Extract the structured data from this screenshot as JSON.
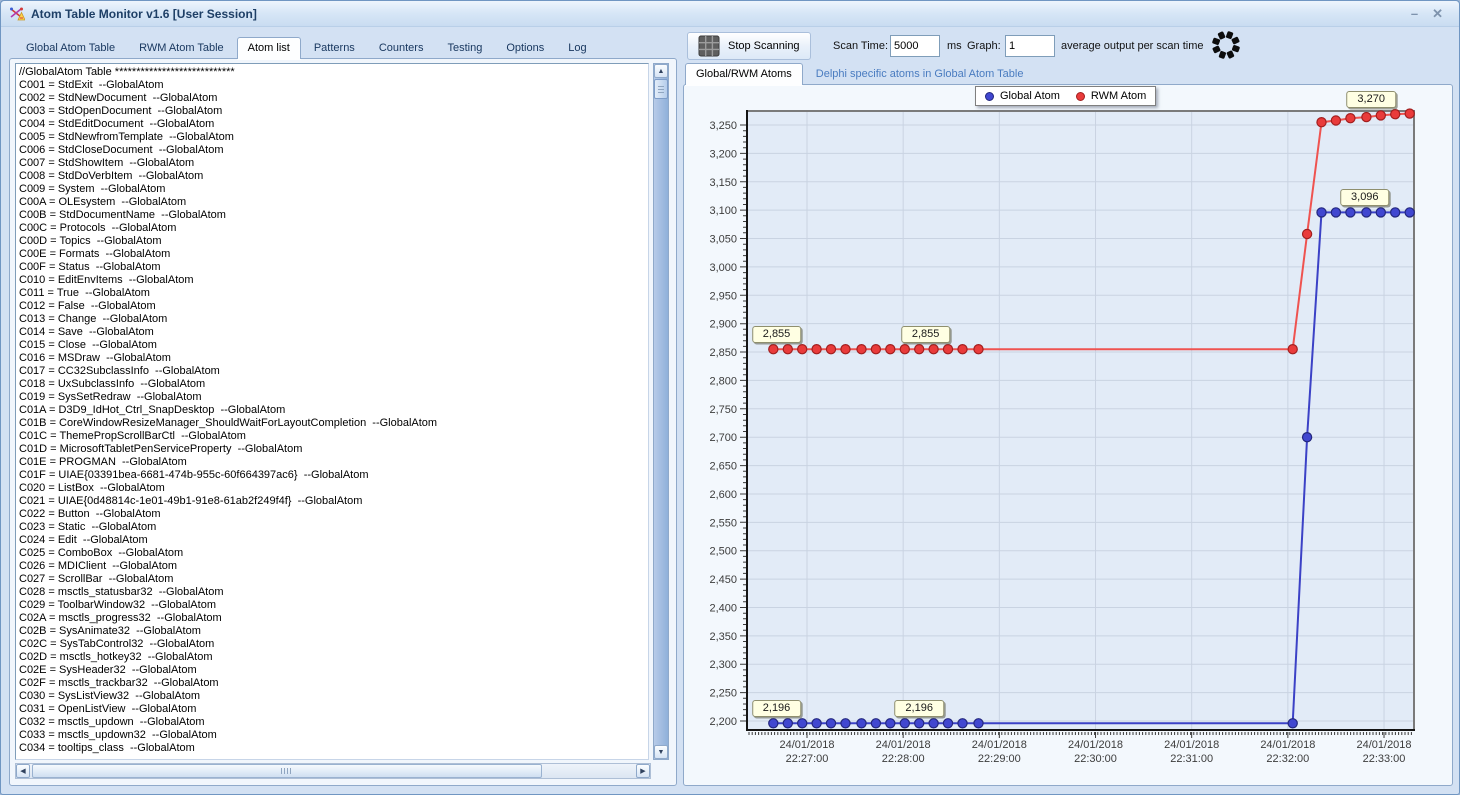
{
  "window": {
    "title": "Atom Table Monitor v1.6 [User Session]",
    "minimize_glyph": "–",
    "close_glyph": "✕"
  },
  "left_tabs": {
    "active_index": 2,
    "items": [
      "Global Atom Table",
      "RWM Atom Table",
      "Atom list",
      "Patterns",
      "Counters",
      "Testing",
      "Options",
      "Log"
    ]
  },
  "atom_list": {
    "lines": [
      "//GlobalAtom Table ****************************",
      "C001 = StdExit  --GlobalAtom",
      "C002 = StdNewDocument  --GlobalAtom",
      "C003 = StdOpenDocument  --GlobalAtom",
      "C004 = StdEditDocument  --GlobalAtom",
      "C005 = StdNewfromTemplate  --GlobalAtom",
      "C006 = StdCloseDocument  --GlobalAtom",
      "C007 = StdShowItem  --GlobalAtom",
      "C008 = StdDoVerbItem  --GlobalAtom",
      "C009 = System  --GlobalAtom",
      "C00A = OLEsystem  --GlobalAtom",
      "C00B = StdDocumentName  --GlobalAtom",
      "C00C = Protocols  --GlobalAtom",
      "C00D = Topics  --GlobalAtom",
      "C00E = Formats  --GlobalAtom",
      "C00F = Status  --GlobalAtom",
      "C010 = EditEnvItems  --GlobalAtom",
      "C011 = True  --GlobalAtom",
      "C012 = False  --GlobalAtom",
      "C013 = Change  --GlobalAtom",
      "C014 = Save  --GlobalAtom",
      "C015 = Close  --GlobalAtom",
      "C016 = MSDraw  --GlobalAtom",
      "C017 = CC32SubclassInfo  --GlobalAtom",
      "C018 = UxSubclassInfo  --GlobalAtom",
      "C019 = SysSetRedraw  --GlobalAtom",
      "C01A = D3D9_IdHot_Ctrl_SnapDesktop  --GlobalAtom",
      "C01B = CoreWindowResizeManager_ShouldWaitForLayoutCompletion  --GlobalAtom",
      "C01C = ThemePropScrollBarCtl  --GlobalAtom",
      "C01D = MicrosoftTabletPenServiceProperty  --GlobalAtom",
      "C01E = PROGMAN  --GlobalAtom",
      "C01F = UIAE{03391bea-6681-474b-955c-60f664397ac6}  --GlobalAtom",
      "C020 = ListBox  --GlobalAtom",
      "C021 = UIAE{0d48814c-1e01-49b1-91e8-61ab2f249f4f}  --GlobalAtom",
      "C022 = Button  --GlobalAtom",
      "C023 = Static  --GlobalAtom",
      "C024 = Edit  --GlobalAtom",
      "C025 = ComboBox  --GlobalAtom",
      "C026 = MDIClient  --GlobalAtom",
      "C027 = ScrollBar  --GlobalAtom",
      "C028 = msctls_statusbar32  --GlobalAtom",
      "C029 = ToolbarWindow32  --GlobalAtom",
      "C02A = msctls_progress32  --GlobalAtom",
      "C02B = SysAnimate32  --GlobalAtom",
      "C02C = SysTabControl32  --GlobalAtom",
      "C02D = msctls_hotkey32  --GlobalAtom",
      "C02E = SysHeader32  --GlobalAtom",
      "C02F = msctls_trackbar32  --GlobalAtom",
      "C030 = SysListView32  --GlobalAtom",
      "C031 = OpenListView  --GlobalAtom",
      "C032 = msctls_updown  --GlobalAtom",
      "C033 = msctls_updown32  --GlobalAtom",
      "C034 = tooltips_class  --GlobalAtom"
    ]
  },
  "toolbar": {
    "stop_button_label": "Stop Scanning",
    "scan_time_label": "Scan Time:",
    "scan_time_value": "5000",
    "ms_label": "ms",
    "graph_label": "Graph:",
    "graph_value": "1",
    "avg_label": "average output per scan time"
  },
  "right_tabs": {
    "active_index": 0,
    "items": [
      "Global/RWM Atoms",
      "Delphi specific atoms in Global Atom Table"
    ]
  },
  "chart_data": {
    "type": "line",
    "title": "",
    "xlabel": "",
    "ylabel": "",
    "ylim": [
      2200,
      3250
    ],
    "ytick_step": 50,
    "grid": true,
    "legend_position": "top-center",
    "legend": [
      {
        "name": "Global Atom",
        "color": "#4147d0",
        "stroke": "#23277e"
      },
      {
        "name": "RWM Atom",
        "color": "#e93b3b",
        "stroke": "#a21f1f"
      }
    ],
    "x_ticks": [
      {
        "date": "24/01/2018",
        "time": "22:27:00"
      },
      {
        "date": "24/01/2018",
        "time": "22:28:00"
      },
      {
        "date": "24/01/2018",
        "time": "22:29:00"
      },
      {
        "date": "24/01/2018",
        "time": "22:30:00"
      },
      {
        "date": "24/01/2018",
        "time": "22:31:00"
      },
      {
        "date": "24/01/2018",
        "time": "22:32:00"
      },
      {
        "date": "24/01/2018",
        "time": "22:33:00"
      }
    ],
    "series": [
      {
        "name": "Global Atom",
        "line_color": "#3b41c6",
        "marker_fill": "#4147d0",
        "marker_stroke": "#23277e",
        "points": [
          [
            "22:26:39",
            2196
          ],
          [
            "22:26:48",
            2196
          ],
          [
            "22:26:57",
            2196
          ],
          [
            "22:27:06",
            2196
          ],
          [
            "22:27:15",
            2196
          ],
          [
            "22:27:24",
            2196
          ],
          [
            "22:27:34",
            2196
          ],
          [
            "22:27:43",
            2196
          ],
          [
            "22:27:52",
            2196
          ],
          [
            "22:28:01",
            2196
          ],
          [
            "22:28:10",
            2196
          ],
          [
            "22:28:19",
            2196
          ],
          [
            "22:28:28",
            2196
          ],
          [
            "22:28:37",
            2196
          ],
          [
            "22:28:47",
            2196
          ],
          [
            "22:32:03",
            2196
          ],
          [
            "22:32:12",
            2700
          ],
          [
            "22:32:21",
            3096
          ],
          [
            "22:32:30",
            3096
          ],
          [
            "22:32:39",
            3096
          ],
          [
            "22:32:49",
            3096
          ],
          [
            "22:32:58",
            3096
          ],
          [
            "22:33:07",
            3096
          ],
          [
            "22:33:16",
            3096
          ]
        ]
      },
      {
        "name": "RWM Atom",
        "line_color": "#ef5350",
        "marker_fill": "#e93b3b",
        "marker_stroke": "#a21f1f",
        "points": [
          [
            "22:26:39",
            2855
          ],
          [
            "22:26:48",
            2855
          ],
          [
            "22:26:57",
            2855
          ],
          [
            "22:27:06",
            2855
          ],
          [
            "22:27:15",
            2855
          ],
          [
            "22:27:24",
            2855
          ],
          [
            "22:27:34",
            2855
          ],
          [
            "22:27:43",
            2855
          ],
          [
            "22:27:52",
            2855
          ],
          [
            "22:28:01",
            2855
          ],
          [
            "22:28:10",
            2855
          ],
          [
            "22:28:19",
            2855
          ],
          [
            "22:28:28",
            2855
          ],
          [
            "22:28:37",
            2855
          ],
          [
            "22:28:47",
            2855
          ],
          [
            "22:32:03",
            2855
          ],
          [
            "22:32:12",
            3058
          ],
          [
            "22:32:21",
            3255
          ],
          [
            "22:32:30",
            3258
          ],
          [
            "22:32:39",
            3262
          ],
          [
            "22:32:49",
            3264
          ],
          [
            "22:32:58",
            3267
          ],
          [
            "22:33:07",
            3269
          ],
          [
            "22:33:16",
            3270
          ]
        ]
      }
    ],
    "annotations": [
      {
        "text": "2,855",
        "time": "22:26:41",
        "value": 2855
      },
      {
        "text": "2,855",
        "time": "22:28:14",
        "value": 2855
      },
      {
        "text": "2,196",
        "time": "22:26:41",
        "value": 2196
      },
      {
        "text": "2,196",
        "time": "22:28:10",
        "value": 2196
      },
      {
        "text": "3,270",
        "time": "22:32:52",
        "value": 3270
      },
      {
        "text": "3,096",
        "time": "22:32:48",
        "value": 3096
      }
    ]
  }
}
